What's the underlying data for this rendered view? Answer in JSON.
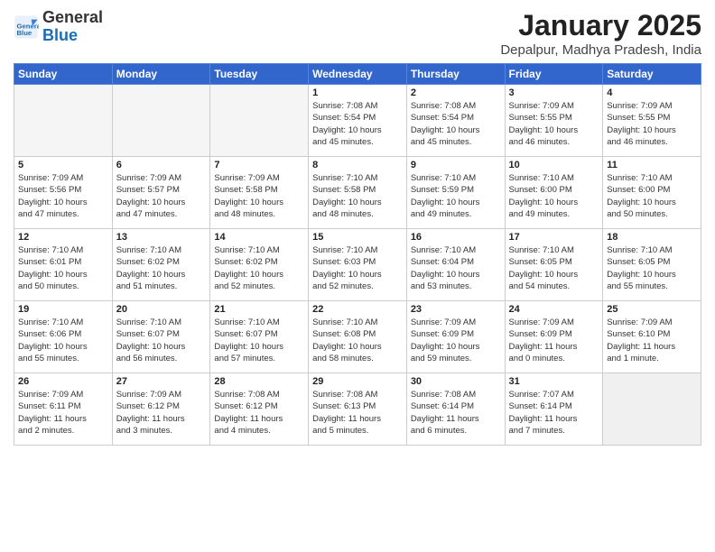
{
  "header": {
    "logo_line1": "General",
    "logo_line2": "Blue",
    "month_title": "January 2025",
    "location": "Depalpur, Madhya Pradesh, India"
  },
  "days_of_week": [
    "Sunday",
    "Monday",
    "Tuesday",
    "Wednesday",
    "Thursday",
    "Friday",
    "Saturday"
  ],
  "weeks": [
    [
      {
        "day": "",
        "info": ""
      },
      {
        "day": "",
        "info": ""
      },
      {
        "day": "",
        "info": ""
      },
      {
        "day": "1",
        "info": "Sunrise: 7:08 AM\nSunset: 5:54 PM\nDaylight: 10 hours\nand 45 minutes."
      },
      {
        "day": "2",
        "info": "Sunrise: 7:08 AM\nSunset: 5:54 PM\nDaylight: 10 hours\nand 45 minutes."
      },
      {
        "day": "3",
        "info": "Sunrise: 7:09 AM\nSunset: 5:55 PM\nDaylight: 10 hours\nand 46 minutes."
      },
      {
        "day": "4",
        "info": "Sunrise: 7:09 AM\nSunset: 5:55 PM\nDaylight: 10 hours\nand 46 minutes."
      }
    ],
    [
      {
        "day": "5",
        "info": "Sunrise: 7:09 AM\nSunset: 5:56 PM\nDaylight: 10 hours\nand 47 minutes."
      },
      {
        "day": "6",
        "info": "Sunrise: 7:09 AM\nSunset: 5:57 PM\nDaylight: 10 hours\nand 47 minutes."
      },
      {
        "day": "7",
        "info": "Sunrise: 7:09 AM\nSunset: 5:58 PM\nDaylight: 10 hours\nand 48 minutes."
      },
      {
        "day": "8",
        "info": "Sunrise: 7:10 AM\nSunset: 5:58 PM\nDaylight: 10 hours\nand 48 minutes."
      },
      {
        "day": "9",
        "info": "Sunrise: 7:10 AM\nSunset: 5:59 PM\nDaylight: 10 hours\nand 49 minutes."
      },
      {
        "day": "10",
        "info": "Sunrise: 7:10 AM\nSunset: 6:00 PM\nDaylight: 10 hours\nand 49 minutes."
      },
      {
        "day": "11",
        "info": "Sunrise: 7:10 AM\nSunset: 6:00 PM\nDaylight: 10 hours\nand 50 minutes."
      }
    ],
    [
      {
        "day": "12",
        "info": "Sunrise: 7:10 AM\nSunset: 6:01 PM\nDaylight: 10 hours\nand 50 minutes."
      },
      {
        "day": "13",
        "info": "Sunrise: 7:10 AM\nSunset: 6:02 PM\nDaylight: 10 hours\nand 51 minutes."
      },
      {
        "day": "14",
        "info": "Sunrise: 7:10 AM\nSunset: 6:02 PM\nDaylight: 10 hours\nand 52 minutes."
      },
      {
        "day": "15",
        "info": "Sunrise: 7:10 AM\nSunset: 6:03 PM\nDaylight: 10 hours\nand 52 minutes."
      },
      {
        "day": "16",
        "info": "Sunrise: 7:10 AM\nSunset: 6:04 PM\nDaylight: 10 hours\nand 53 minutes."
      },
      {
        "day": "17",
        "info": "Sunrise: 7:10 AM\nSunset: 6:05 PM\nDaylight: 10 hours\nand 54 minutes."
      },
      {
        "day": "18",
        "info": "Sunrise: 7:10 AM\nSunset: 6:05 PM\nDaylight: 10 hours\nand 55 minutes."
      }
    ],
    [
      {
        "day": "19",
        "info": "Sunrise: 7:10 AM\nSunset: 6:06 PM\nDaylight: 10 hours\nand 55 minutes."
      },
      {
        "day": "20",
        "info": "Sunrise: 7:10 AM\nSunset: 6:07 PM\nDaylight: 10 hours\nand 56 minutes."
      },
      {
        "day": "21",
        "info": "Sunrise: 7:10 AM\nSunset: 6:07 PM\nDaylight: 10 hours\nand 57 minutes."
      },
      {
        "day": "22",
        "info": "Sunrise: 7:10 AM\nSunset: 6:08 PM\nDaylight: 10 hours\nand 58 minutes."
      },
      {
        "day": "23",
        "info": "Sunrise: 7:09 AM\nSunset: 6:09 PM\nDaylight: 10 hours\nand 59 minutes."
      },
      {
        "day": "24",
        "info": "Sunrise: 7:09 AM\nSunset: 6:09 PM\nDaylight: 11 hours\nand 0 minutes."
      },
      {
        "day": "25",
        "info": "Sunrise: 7:09 AM\nSunset: 6:10 PM\nDaylight: 11 hours\nand 1 minute."
      }
    ],
    [
      {
        "day": "26",
        "info": "Sunrise: 7:09 AM\nSunset: 6:11 PM\nDaylight: 11 hours\nand 2 minutes."
      },
      {
        "day": "27",
        "info": "Sunrise: 7:09 AM\nSunset: 6:12 PM\nDaylight: 11 hours\nand 3 minutes."
      },
      {
        "day": "28",
        "info": "Sunrise: 7:08 AM\nSunset: 6:12 PM\nDaylight: 11 hours\nand 4 minutes."
      },
      {
        "day": "29",
        "info": "Sunrise: 7:08 AM\nSunset: 6:13 PM\nDaylight: 11 hours\nand 5 minutes."
      },
      {
        "day": "30",
        "info": "Sunrise: 7:08 AM\nSunset: 6:14 PM\nDaylight: 11 hours\nand 6 minutes."
      },
      {
        "day": "31",
        "info": "Sunrise: 7:07 AM\nSunset: 6:14 PM\nDaylight: 11 hours\nand 7 minutes."
      },
      {
        "day": "",
        "info": ""
      }
    ]
  ]
}
